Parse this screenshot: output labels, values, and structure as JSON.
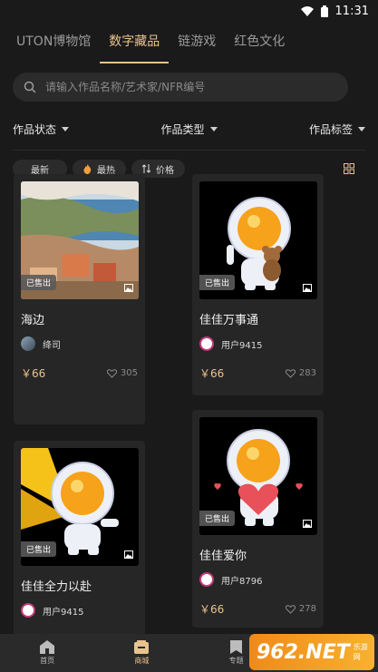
{
  "status": {
    "time": "11:31"
  },
  "tabs": [
    {
      "label": "UTON博物馆"
    },
    {
      "label": "数字藏品"
    },
    {
      "label": "链游戏"
    },
    {
      "label": "红色文化"
    }
  ],
  "search": {
    "placeholder": "请输入作品名称/艺术家/NFR编号"
  },
  "filters": [
    {
      "label": "作品状态"
    },
    {
      "label": "作品类型"
    },
    {
      "label": "作品标签"
    }
  ],
  "sort": [
    {
      "label": "最新"
    },
    {
      "label": "最热",
      "icon": "flame-icon"
    },
    {
      "label": "价格",
      "icon": "sort-icon"
    }
  ],
  "cards": [
    {
      "title": "海边",
      "author": "绛司",
      "price": "￥66",
      "likes": "305",
      "badge": "已售出"
    },
    {
      "title": "佳佳万事通",
      "author": "用户9415",
      "price": "￥66",
      "likes": "283",
      "badge": "已售出"
    },
    {
      "title": "佳佳全力以赴",
      "author": "用户9415",
      "price": "",
      "likes": "",
      "badge": "已售出"
    },
    {
      "title": "佳佳爱你",
      "author": "用户8796",
      "price": "￥66",
      "likes": "278",
      "badge": "已售出"
    }
  ],
  "nav": [
    {
      "label": "首页"
    },
    {
      "label": "商城"
    },
    {
      "label": "专题"
    }
  ],
  "watermark": {
    "text": "962.NET",
    "sub": "乐游网"
  },
  "colors": {
    "accent": "#e9c38e",
    "background": "#1a1a1a",
    "card": "#262626"
  }
}
